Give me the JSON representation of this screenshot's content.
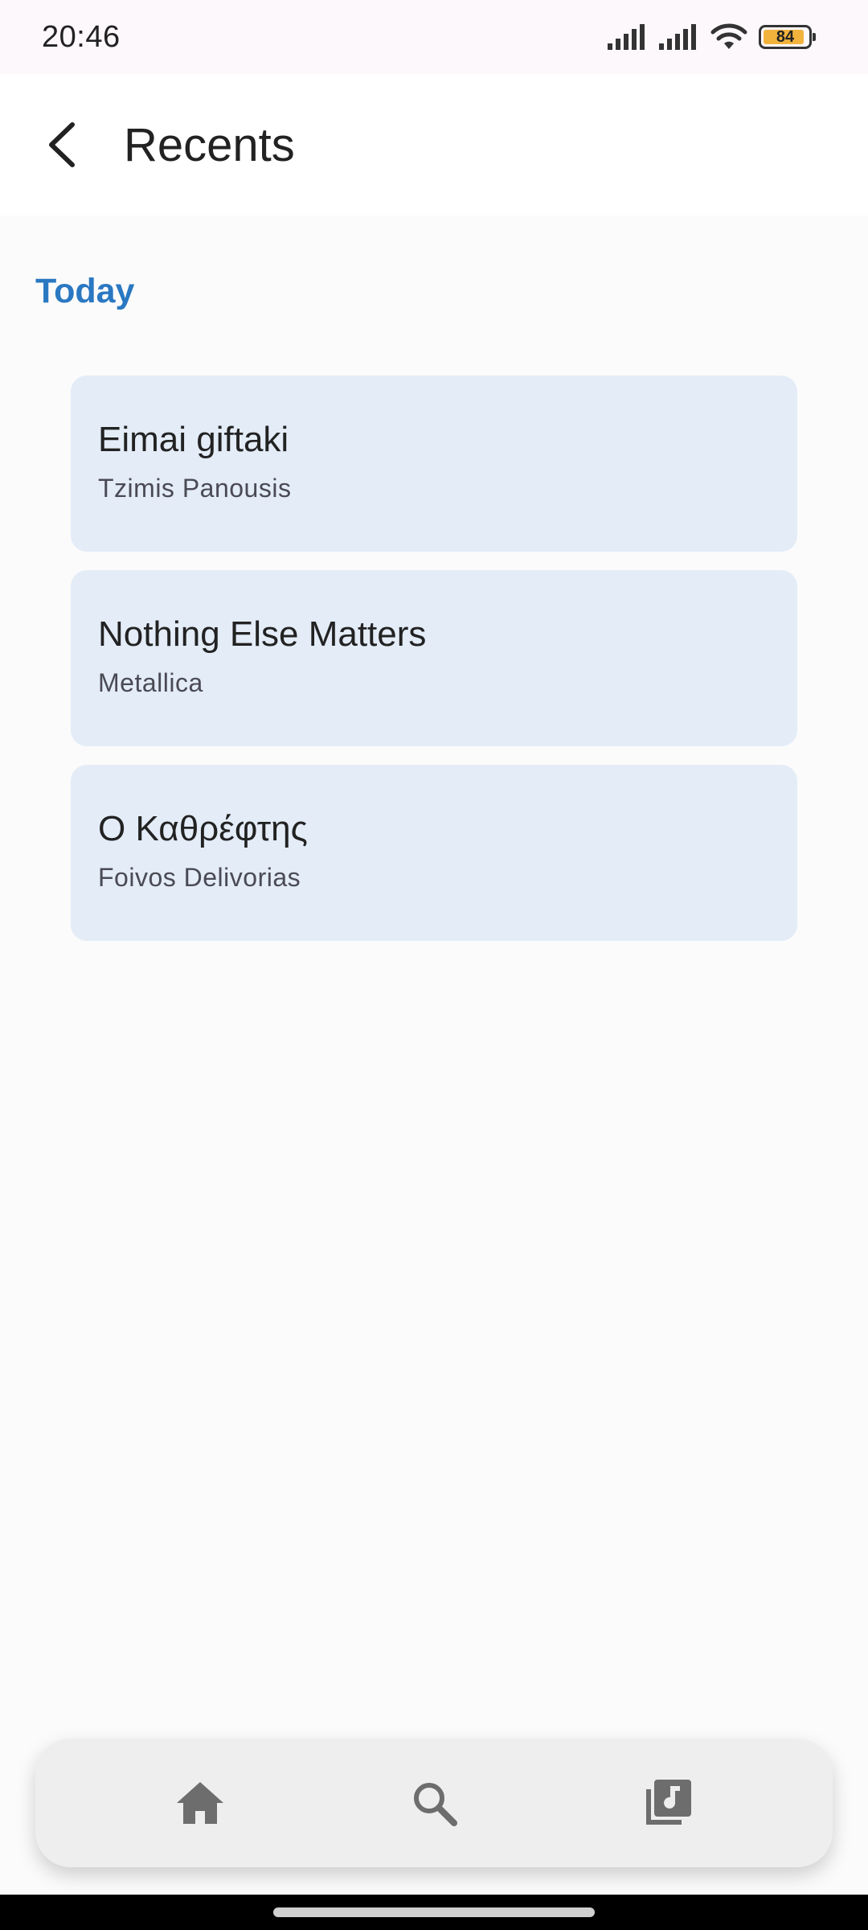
{
  "status_bar": {
    "time": "20:46",
    "battery_level": "84",
    "icons": [
      "signal-icon",
      "signal-icon",
      "wifi-icon",
      "battery-icon"
    ]
  },
  "app_bar": {
    "title": "Recents",
    "back_icon": "back-arrow-icon"
  },
  "section": {
    "heading": "Today",
    "accent_color": "#2a78c2"
  },
  "recents": [
    {
      "title": "Eimai giftaki",
      "artist": "Tzimis Panousis"
    },
    {
      "title": "Nothing Else Matters",
      "artist": "Metallica"
    },
    {
      "title": "Ο Καθρέφτης",
      "artist": "Foivos Delivorias"
    }
  ],
  "bottom_nav": {
    "items": [
      {
        "icon": "home-icon"
      },
      {
        "icon": "search-icon"
      },
      {
        "icon": "library-music-icon"
      }
    ]
  },
  "colors": {
    "card_background": "#e3ecf7",
    "page_background": "#fbfbfb",
    "nav_background": "#eeeeee"
  }
}
